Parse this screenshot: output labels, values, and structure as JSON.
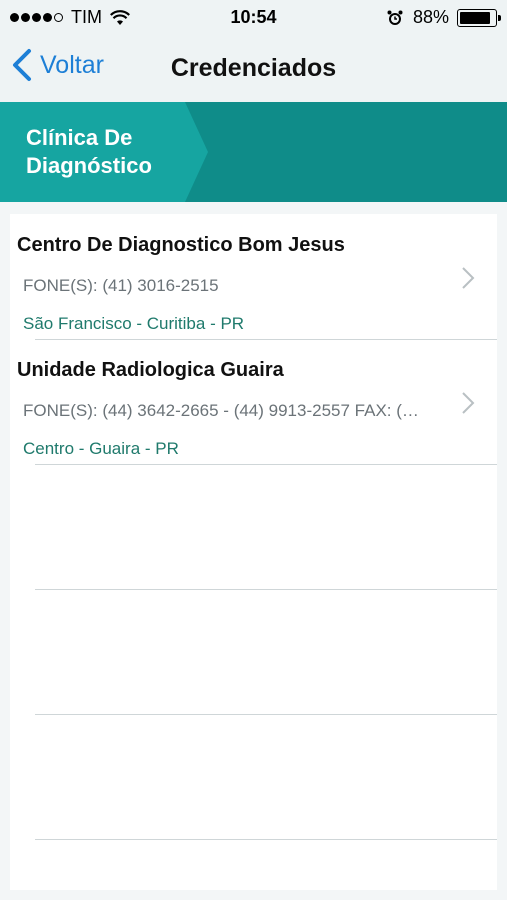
{
  "status_bar": {
    "carrier": "TIM",
    "time": "10:54",
    "battery": "88%",
    "battery_level": 0.88
  },
  "nav": {
    "back_label": "Voltar",
    "title": "Credenciados"
  },
  "breadcrumb": {
    "active_label": "Clínica De Diagnóstico"
  },
  "providers": [
    {
      "name": "Centro De Diagnostico Bom Jesus",
      "phones": "FONE(S): (41) 3016-2515",
      "location": "São Francisco - Curitiba - PR"
    },
    {
      "name": "Unidade Radiologica Guaira",
      "phones": "FONE(S): (44) 3642-2665  - (44) 9913-2557  FAX: (…",
      "location": "Centro - Guaira - PR"
    }
  ],
  "colors": {
    "accent": "#1d7fd6",
    "teal_band": "#0f8c89",
    "teal_active": "#16a5a1",
    "location_text": "#1f7a6c"
  }
}
